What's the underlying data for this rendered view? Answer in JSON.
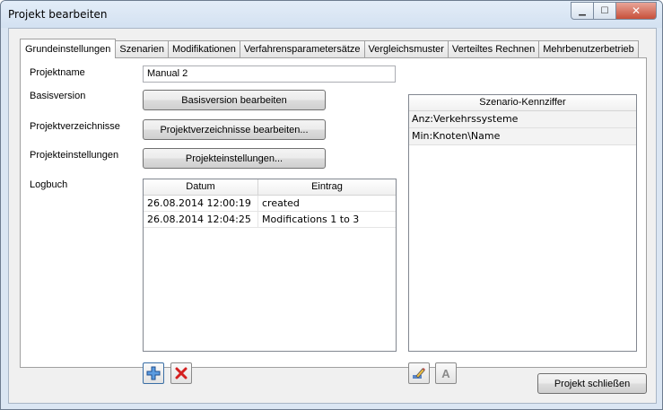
{
  "window": {
    "title": "Projekt bearbeiten",
    "minimize_glyph": "▁",
    "maximize_glyph": "☐",
    "close_glyph": "✕"
  },
  "tabs": [
    {
      "label": "Grundeinstellungen",
      "active": true
    },
    {
      "label": "Szenarien",
      "active": false
    },
    {
      "label": "Modifikationen",
      "active": false
    },
    {
      "label": "Verfahrensparametersätze",
      "active": false
    },
    {
      "label": "Vergleichsmuster",
      "active": false
    },
    {
      "label": "Verteiltes Rechnen",
      "active": false
    },
    {
      "label": "Mehrbenutzerbetrieb",
      "active": false
    }
  ],
  "form": {
    "projektname_label": "Projektname",
    "projektname_value": "Manual 2",
    "basisversion_label": "Basisversion",
    "basisversion_button": "Basisversion bearbeiten",
    "projektverzeichnisse_label": "Projektverzeichnisse",
    "projektverzeichnisse_button": "Projektverzeichnisse bearbeiten...",
    "projekteinstellungen_label": "Projekteinstellungen",
    "projekteinstellungen_button": "Projekteinstellungen...",
    "logbuch_label": "Logbuch"
  },
  "logbuch": {
    "columns": [
      "Datum",
      "Eintrag"
    ],
    "rows": [
      [
        "26.08.2014 12:00:19",
        "created"
      ],
      [
        "26.08.2014 12:04:25",
        "Modifications 1 to 3"
      ]
    ]
  },
  "scenario": {
    "header": "Szenario-Kennziffer",
    "items": [
      "Anz:Verkehrssysteme",
      "Min:Knoten\\Name"
    ],
    "edit_icon": "pencil-icon",
    "text_button_label": "A"
  },
  "toolbar": {
    "add_icon": "plus-icon",
    "delete_icon": "delete-x-icon",
    "accent_blue": "#2f6fc2",
    "accent_red": "#d42020"
  },
  "footer": {
    "close_button": "Projekt schließen"
  }
}
